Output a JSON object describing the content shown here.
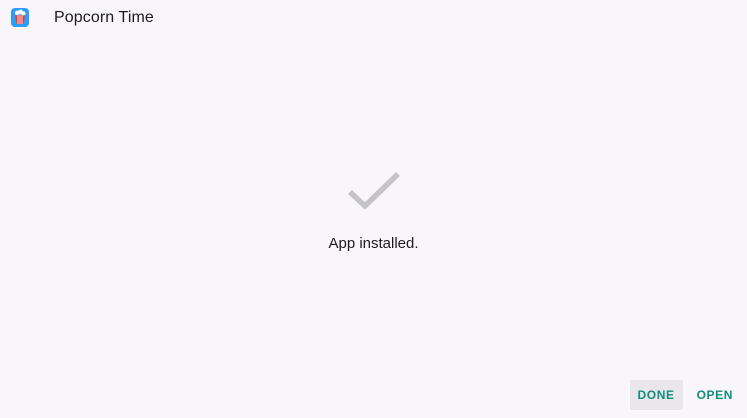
{
  "app": {
    "title": "Popcorn Time",
    "icon": "popcorn-time-app-icon"
  },
  "status": {
    "icon": "checkmark-icon",
    "message": "App installed."
  },
  "actions": {
    "done_label": "DONE",
    "open_label": "OPEN"
  },
  "colors": {
    "background": "#f8f5fb",
    "accent": "#0f8f7a",
    "check": "#c4c4c4",
    "pressed_button_bg": "#e9e6ec"
  }
}
